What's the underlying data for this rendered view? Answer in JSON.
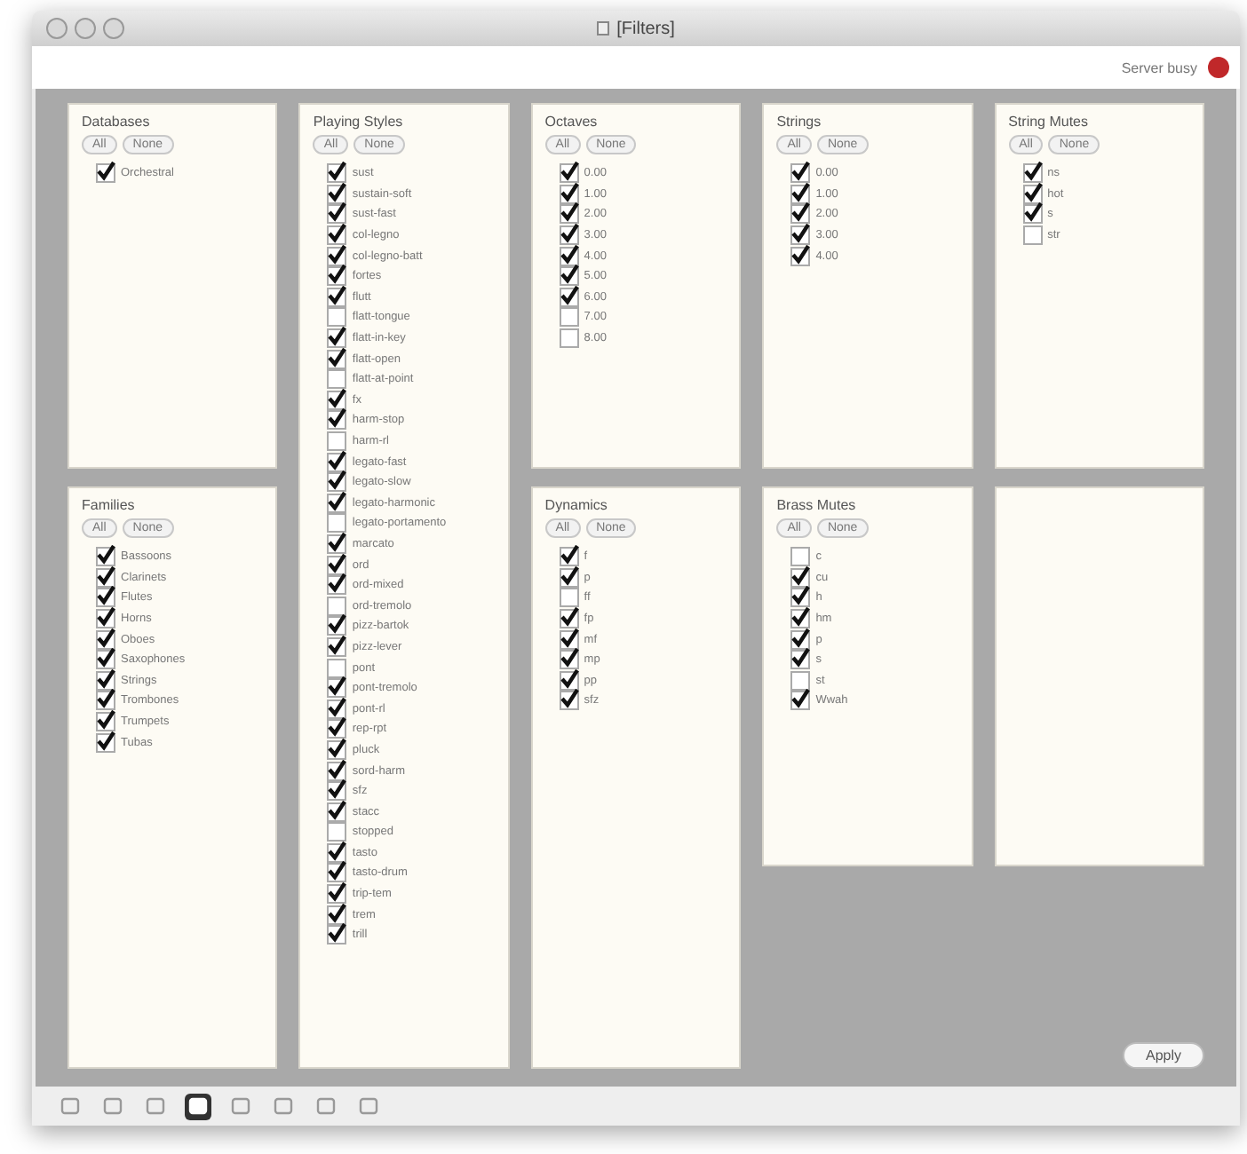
{
  "window": {
    "title": "[Filters]"
  },
  "status": {
    "text": "Server busy",
    "color": "#c0282a"
  },
  "panels": [
    {
      "kind": "checklist",
      "title": "Databases",
      "buttons": [
        "All",
        "None"
      ],
      "items": [
        {
          "label": "Orchestral",
          "checked": true
        }
      ]
    },
    {
      "kind": "checklist",
      "title": "Families",
      "buttons": [
        "All",
        "None"
      ],
      "items": [
        {
          "label": "Bassoons",
          "checked": true
        },
        {
          "label": "Clarinets",
          "checked": true
        },
        {
          "label": "Flutes",
          "checked": true
        },
        {
          "label": "Horns",
          "checked": true
        },
        {
          "label": "Oboes",
          "checked": true
        },
        {
          "label": "Saxophones",
          "checked": true
        },
        {
          "label": "Strings",
          "checked": true
        },
        {
          "label": "Trombones",
          "checked": true
        },
        {
          "label": "Trumpets",
          "checked": true
        },
        {
          "label": "Tubas",
          "checked": true
        }
      ]
    },
    {
      "kind": "checklist",
      "title": "Playing Styles",
      "buttons": [
        "All",
        "None"
      ],
      "items": [
        {
          "label": "sust",
          "checked": true
        },
        {
          "label": "sustain-soft",
          "checked": true
        },
        {
          "label": "sust-fast",
          "checked": true
        },
        {
          "label": "col-legno",
          "checked": true
        },
        {
          "label": "col-legno-batt",
          "checked": true
        },
        {
          "label": "fortes",
          "checked": true
        },
        {
          "label": "flutt",
          "checked": true
        },
        {
          "label": "flatt-tongue",
          "checked": false
        },
        {
          "label": "flatt-in-key",
          "checked": true
        },
        {
          "label": "flatt-open",
          "checked": true
        },
        {
          "label": "flatt-at-point",
          "checked": false
        },
        {
          "label": "fx",
          "checked": true
        },
        {
          "label": "harm-stop",
          "checked": true
        },
        {
          "label": "harm-rl",
          "checked": false
        },
        {
          "label": "legato-fast",
          "checked": true
        },
        {
          "label": "legato-slow",
          "checked": true
        },
        {
          "label": "legato-harmonic",
          "checked": true
        },
        {
          "label": "legato-portamento",
          "checked": false
        },
        {
          "label": "marcato",
          "checked": true
        },
        {
          "label": "ord",
          "checked": true
        },
        {
          "label": "ord-mixed",
          "checked": true
        },
        {
          "label": "ord-tremolo",
          "checked": false
        },
        {
          "label": "pizz-bartok",
          "checked": true
        },
        {
          "label": "pizz-lever",
          "checked": true
        },
        {
          "label": "pont",
          "checked": false
        },
        {
          "label": "pont-tremolo",
          "checked": true
        },
        {
          "label": "pont-rl",
          "checked": true
        },
        {
          "label": "rep-rpt",
          "checked": true
        },
        {
          "label": "pluck",
          "checked": true
        },
        {
          "label": "sord-harm",
          "checked": true
        },
        {
          "label": "sfz",
          "checked": true
        },
        {
          "label": "stacc",
          "checked": true
        },
        {
          "label": "stopped",
          "checked": false
        },
        {
          "label": "tasto",
          "checked": true
        },
        {
          "label": "tasto-drum",
          "checked": true
        },
        {
          "label": "trip-tem",
          "checked": true
        },
        {
          "label": "trem",
          "checked": true
        },
        {
          "label": "trill",
          "checked": true
        }
      ]
    },
    {
      "kind": "checklist",
      "title": "Octaves",
      "buttons": [
        "All",
        "None"
      ],
      "items": [
        {
          "label": "0.00",
          "checked": true
        },
        {
          "label": "1.00",
          "checked": true
        },
        {
          "label": "2.00",
          "checked": true
        },
        {
          "label": "3.00",
          "checked": true
        },
        {
          "label": "4.00",
          "checked": true
        },
        {
          "label": "5.00",
          "checked": true
        },
        {
          "label": "6.00",
          "checked": true
        },
        {
          "label": "7.00",
          "checked": false
        },
        {
          "label": "8.00",
          "checked": false
        }
      ]
    },
    {
      "kind": "checklist",
      "title": "Dynamics",
      "buttons": [
        "All",
        "None"
      ],
      "items": [
        {
          "label": "f",
          "checked": true
        },
        {
          "label": "p",
          "checked": true
        },
        {
          "label": "ff",
          "checked": false
        },
        {
          "label": "fp",
          "checked": true
        },
        {
          "label": "mf",
          "checked": true
        },
        {
          "label": "mp",
          "checked": true
        },
        {
          "label": "pp",
          "checked": true
        },
        {
          "label": "sfz",
          "checked": true
        }
      ]
    },
    {
      "kind": "checklist",
      "title": "Strings",
      "buttons": [
        "All",
        "None"
      ],
      "items": [
        {
          "label": "0.00",
          "checked": true
        },
        {
          "label": "1.00",
          "checked": true
        },
        {
          "label": "2.00",
          "checked": true
        },
        {
          "label": "3.00",
          "checked": true
        },
        {
          "label": "4.00",
          "checked": true
        }
      ]
    },
    {
      "kind": "checklist",
      "title": "Brass Mutes",
      "buttons": [
        "All",
        "None"
      ],
      "items": [
        {
          "label": "c",
          "checked": false
        },
        {
          "label": "cu",
          "checked": true
        },
        {
          "label": "h",
          "checked": true
        },
        {
          "label": "hm",
          "checked": true
        },
        {
          "label": "p",
          "checked": true
        },
        {
          "label": "s",
          "checked": true
        },
        {
          "label": "st",
          "checked": false
        },
        {
          "label": "Wwah",
          "checked": true
        }
      ]
    },
    {
      "kind": "checklist",
      "title": "String Mutes",
      "buttons": [
        "All",
        "None"
      ],
      "items": [
        {
          "label": "ns",
          "checked": true
        },
        {
          "label": "hot",
          "checked": true
        },
        {
          "label": "s",
          "checked": true
        },
        {
          "label": "str",
          "checked": false
        }
      ]
    },
    {
      "kind": "empty"
    }
  ],
  "apply_button": "Apply",
  "toolbar": [
    {
      "selected": false
    },
    {
      "selected": false
    },
    {
      "selected": false
    },
    {
      "selected": true
    },
    {
      "selected": false
    },
    {
      "selected": false
    },
    {
      "selected": false
    },
    {
      "selected": false
    }
  ]
}
